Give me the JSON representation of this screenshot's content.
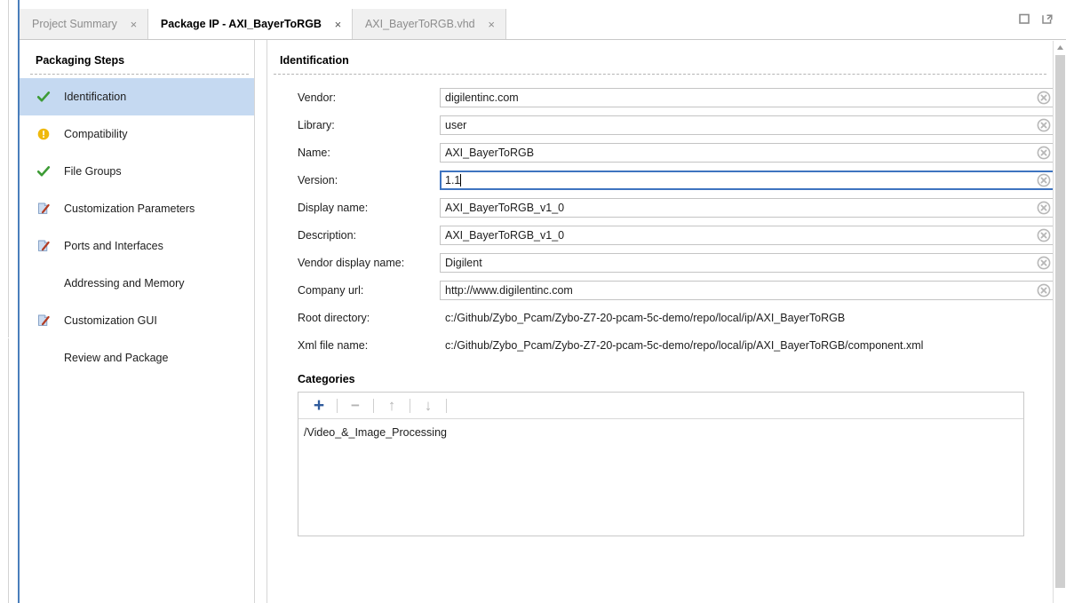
{
  "window": {
    "tabs": [
      {
        "label": "Project Summary",
        "active": false,
        "close_label": "×"
      },
      {
        "label": "Package IP - AXI_BayerToRGB",
        "active": true,
        "close_label": "×"
      },
      {
        "label": "AXI_BayerToRGB.vhd",
        "active": false,
        "close_label": "×"
      }
    ],
    "controls": [
      {
        "name": "maximize-icon",
        "label": "Maximize"
      },
      {
        "name": "float-icon",
        "label": "Float"
      }
    ],
    "active_border_color": "#4a7ebb"
  },
  "sidebar": {
    "title": "Packaging Steps",
    "items": [
      {
        "label": "Identification",
        "icon": "check-icon",
        "selected": true
      },
      {
        "label": "Compatibility",
        "icon": "warning-icon",
        "selected": false
      },
      {
        "label": "File Groups",
        "icon": "check-icon",
        "selected": false
      },
      {
        "label": "Customization Parameters",
        "icon": "edit-icon",
        "selected": false
      },
      {
        "label": "Ports and Interfaces",
        "icon": "edit-icon",
        "selected": false
      },
      {
        "label": "Addressing and Memory",
        "icon": "none",
        "selected": false
      },
      {
        "label": "Customization GUI",
        "icon": "edit-icon",
        "selected": false
      },
      {
        "label": "Review and Package",
        "icon": "none",
        "selected": false
      }
    ],
    "selected_bg": "#c5d9f1",
    "check_color": "#3d9b35",
    "warning_color": "#efb90d"
  },
  "main": {
    "title": "Identification",
    "fields": [
      {
        "label": "Vendor:",
        "value": "digilentinc.com",
        "type": "text",
        "focused": false,
        "clearable": true
      },
      {
        "label": "Library:",
        "value": "user",
        "type": "text",
        "focused": false,
        "clearable": true
      },
      {
        "label": "Name:",
        "value": "AXI_BayerToRGB",
        "type": "text",
        "focused": false,
        "clearable": true
      },
      {
        "label": "Version:",
        "value": "1.1",
        "type": "text",
        "focused": true,
        "clearable": true
      },
      {
        "label": "Display name:",
        "value": "AXI_BayerToRGB_v1_0",
        "type": "text",
        "focused": false,
        "clearable": true
      },
      {
        "label": "Description:",
        "value": "AXI_BayerToRGB_v1_0",
        "type": "text",
        "focused": false,
        "clearable": true
      },
      {
        "label": "Vendor display name:",
        "value": "Digilent",
        "type": "text",
        "focused": false,
        "clearable": true
      },
      {
        "label": "Company url:",
        "value": "http://www.digilentinc.com",
        "type": "text",
        "focused": false,
        "clearable": true
      },
      {
        "label": "Root directory:",
        "value": "c:/Github/Zybo_Pcam/Zybo-Z7-20-pcam-5c-demo/repo/local/ip/AXI_BayerToRGB",
        "type": "readonly",
        "focused": false,
        "clearable": false
      },
      {
        "label": "Xml file name:",
        "value": "c:/Github/Zybo_Pcam/Zybo-Z7-20-pcam-5c-demo/repo/local/ip/AXI_BayerToRGB/component.xml",
        "type": "readonly",
        "focused": false,
        "clearable": false
      }
    ],
    "categories": {
      "title": "Categories",
      "toolbar": [
        {
          "name": "add-category-button",
          "glyph": "+",
          "enabled": true,
          "color": "#2f5b9c"
        },
        {
          "name": "remove-category-button",
          "glyph": "−",
          "enabled": false,
          "color": "#b4b4b4"
        },
        {
          "name": "move-up-category-button",
          "glyph": "↑",
          "enabled": false,
          "color": "#b4b4b4"
        },
        {
          "name": "move-down-category-button",
          "glyph": "↓",
          "enabled": false,
          "color": "#b4b4b4"
        }
      ],
      "items": [
        "/Video_&_Image_Processing"
      ]
    }
  }
}
